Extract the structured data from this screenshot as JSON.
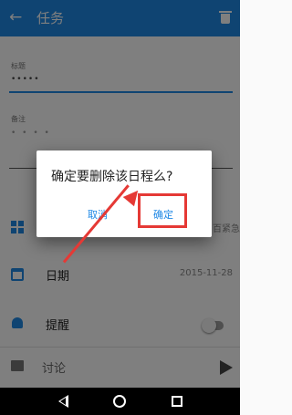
{
  "appbar": {
    "back_icon": "arrow-left-icon",
    "title": "任务",
    "delete_icon": "trash-icon"
  },
  "form": {
    "title_label": "标题",
    "title_value": "•••••",
    "note_label": "备注",
    "note_value": "• • • •"
  },
  "rows": {
    "priority": {
      "icon": "grid-icon",
      "value": "百紧急"
    },
    "date": {
      "icon": "calendar-icon",
      "label": "日期",
      "value": "2015-11-28"
    },
    "reminder": {
      "icon": "bell-icon",
      "label": "提醒",
      "toggle_on": false
    },
    "discuss": {
      "icon": "image-icon",
      "label": "讨论",
      "send_icon": "send-icon"
    }
  },
  "dialog": {
    "message": "确定要删除该日程么?",
    "cancel_label": "取消",
    "ok_label": "确定"
  },
  "navbar": {
    "back_icon": "nav-back-icon",
    "home_icon": "nav-home-icon",
    "recent_icon": "nav-recent-icon"
  },
  "colors": {
    "accent": "#1e88e5",
    "annotation": "#e53935"
  }
}
